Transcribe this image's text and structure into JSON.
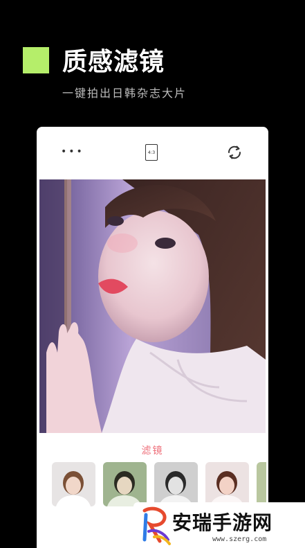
{
  "hero": {
    "title": "质感滤镜",
    "subtitle": "一键拍出日韩杂志大片",
    "accent_color": "#b5ee6a"
  },
  "camera": {
    "more_icon": "more-dots-icon",
    "ratio_label": "4:3",
    "switch_icon": "camera-switch-icon"
  },
  "filters": {
    "title": "滤镜",
    "title_color": "#ee6f7a",
    "items": [
      "filter-original",
      "filter-green",
      "filter-mono",
      "filter-warm",
      "filter-partial"
    ]
  },
  "watermark": {
    "site_name": "安瑞手游网",
    "url": "www.szerg.com"
  }
}
